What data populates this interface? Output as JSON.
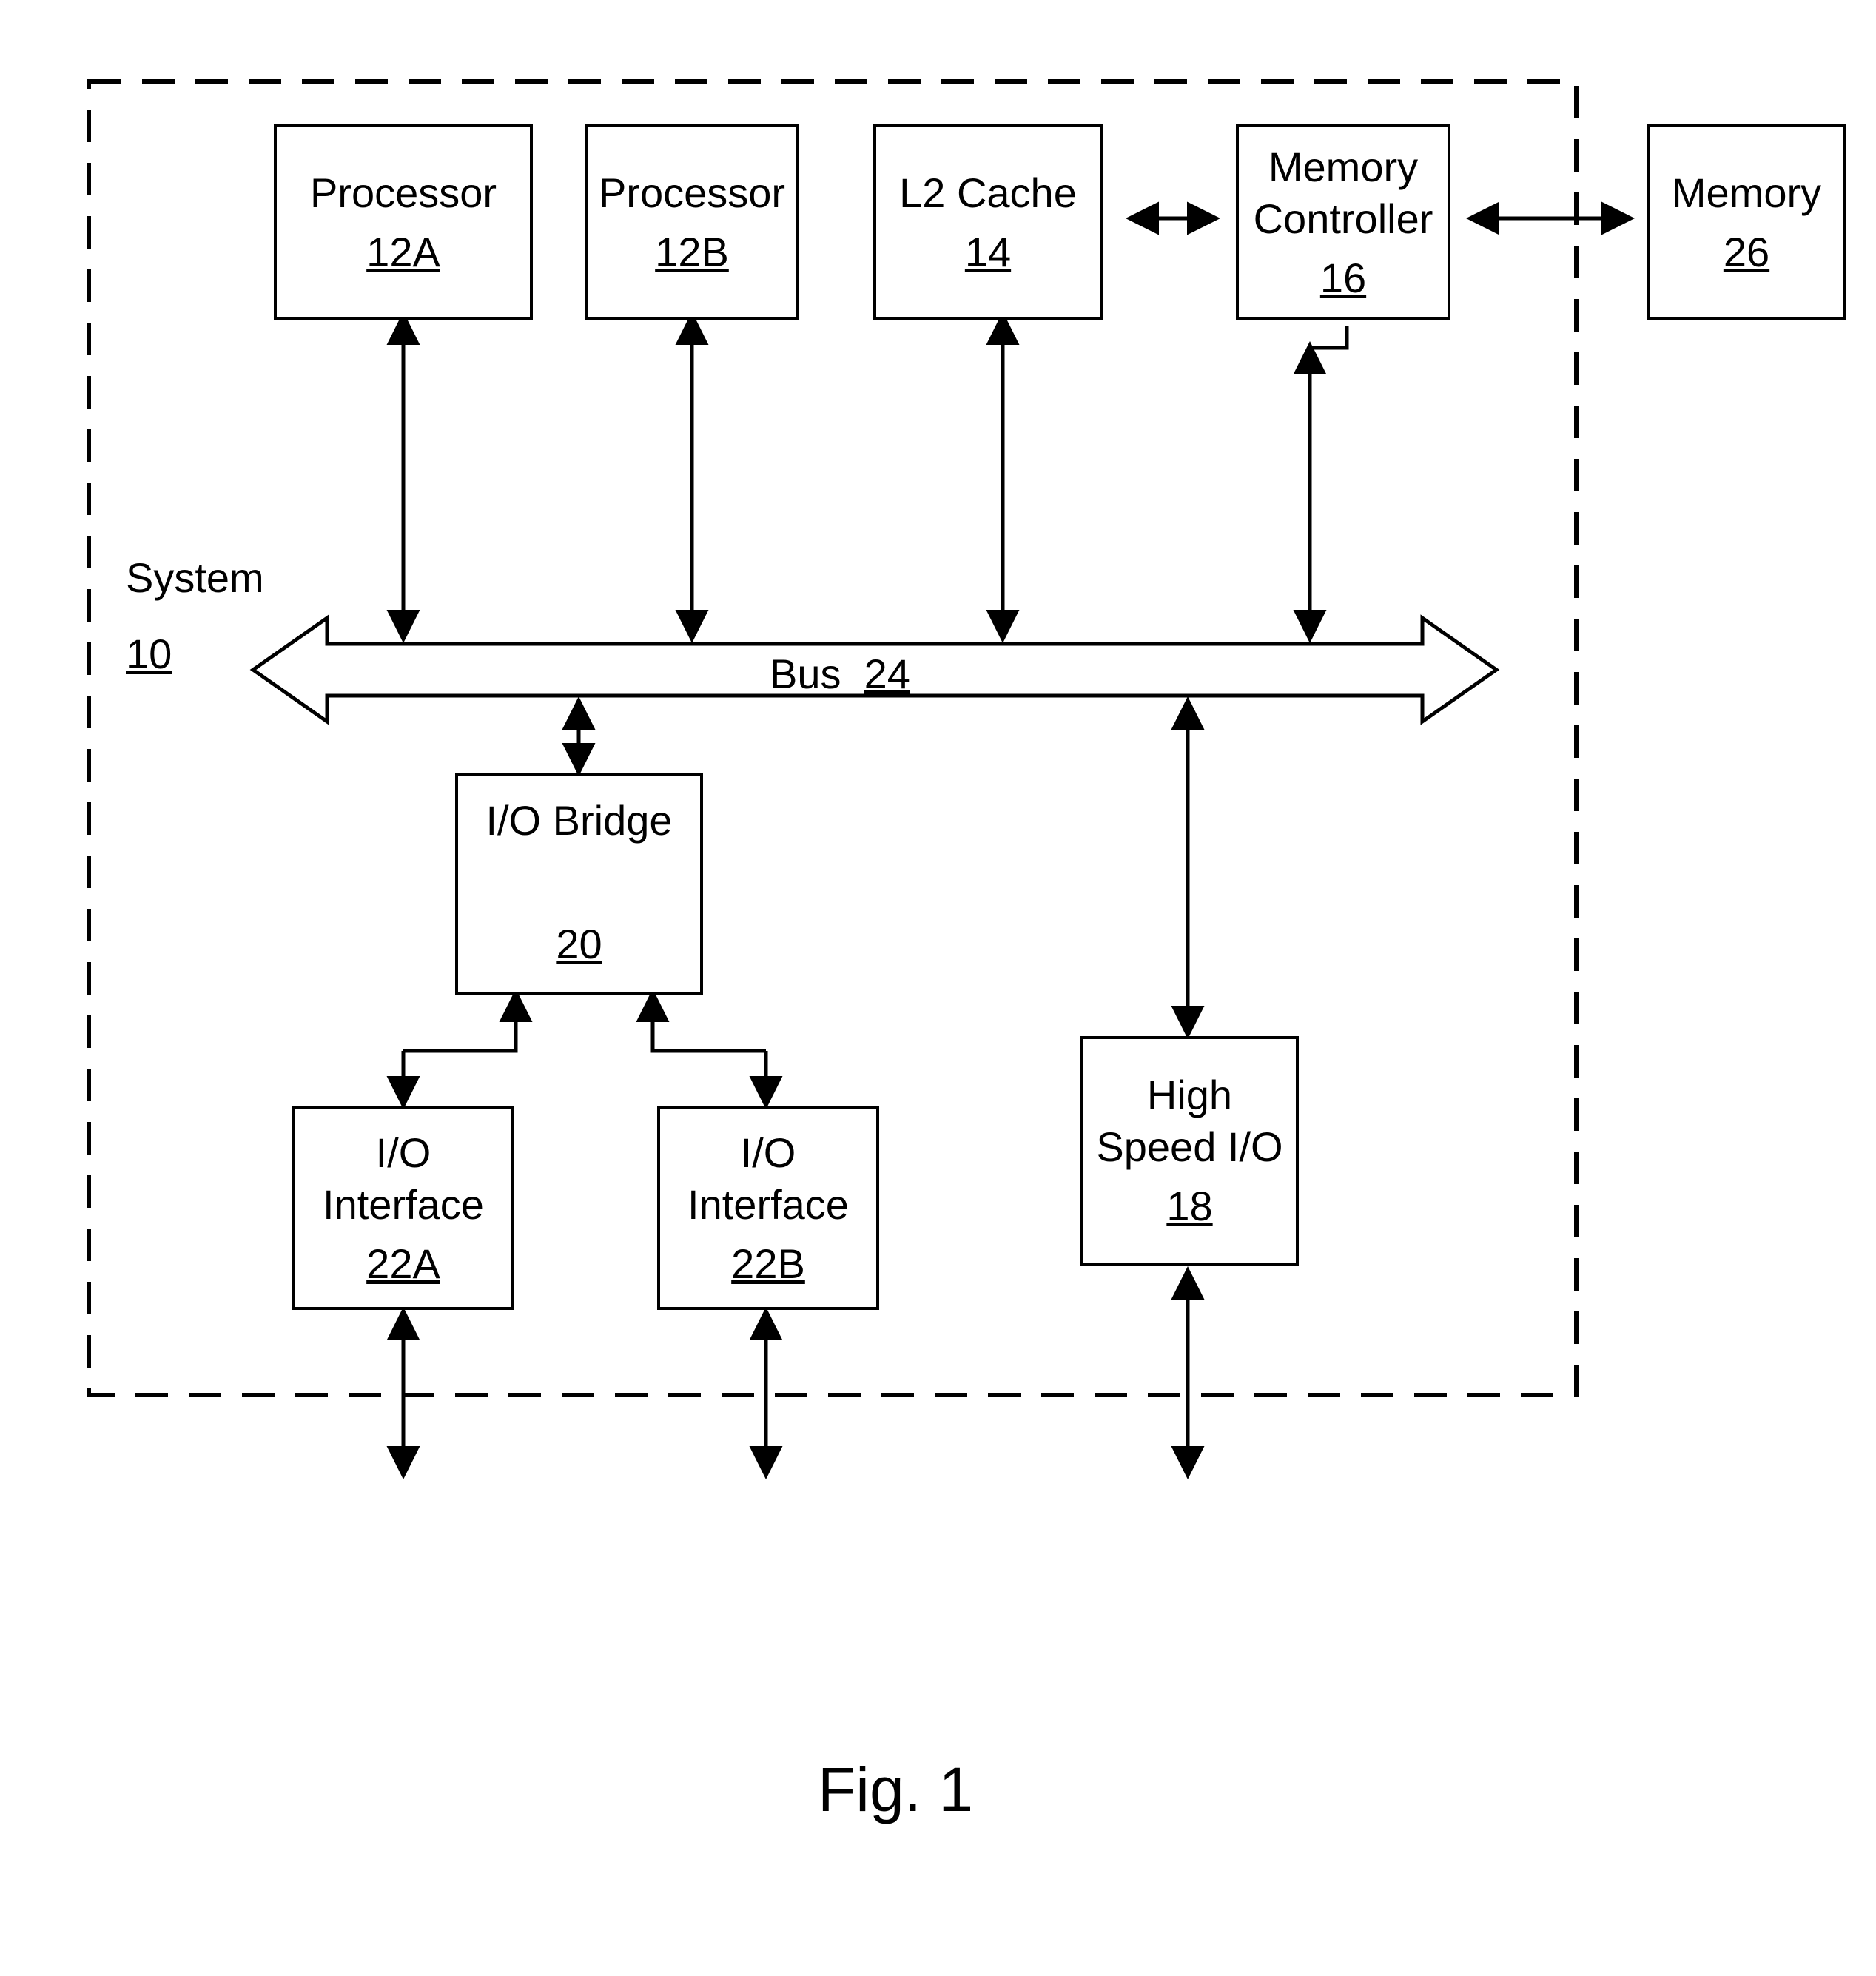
{
  "blocks": {
    "processorA": {
      "label": "Processor",
      "ref": "12A"
    },
    "processorB": {
      "label": "Processor",
      "ref": "12B"
    },
    "l2cache": {
      "label": "L2 Cache",
      "ref": "14"
    },
    "memctrl": {
      "label": "Memory Controller",
      "ref": "16"
    },
    "memory": {
      "label": "Memory",
      "ref": "26"
    },
    "iobridge": {
      "label": "I/O Bridge",
      "ref": "20"
    },
    "iointA": {
      "label": "I/O Interface",
      "ref": "22A"
    },
    "iointB": {
      "label": "I/O Interface",
      "ref": "22B"
    },
    "hsio": {
      "label": "High Speed I/O",
      "ref": "18"
    }
  },
  "bus": {
    "label": "Bus",
    "ref": "24"
  },
  "system": {
    "label": "System",
    "ref": "10"
  },
  "figure": {
    "caption": "Fig. 1"
  }
}
